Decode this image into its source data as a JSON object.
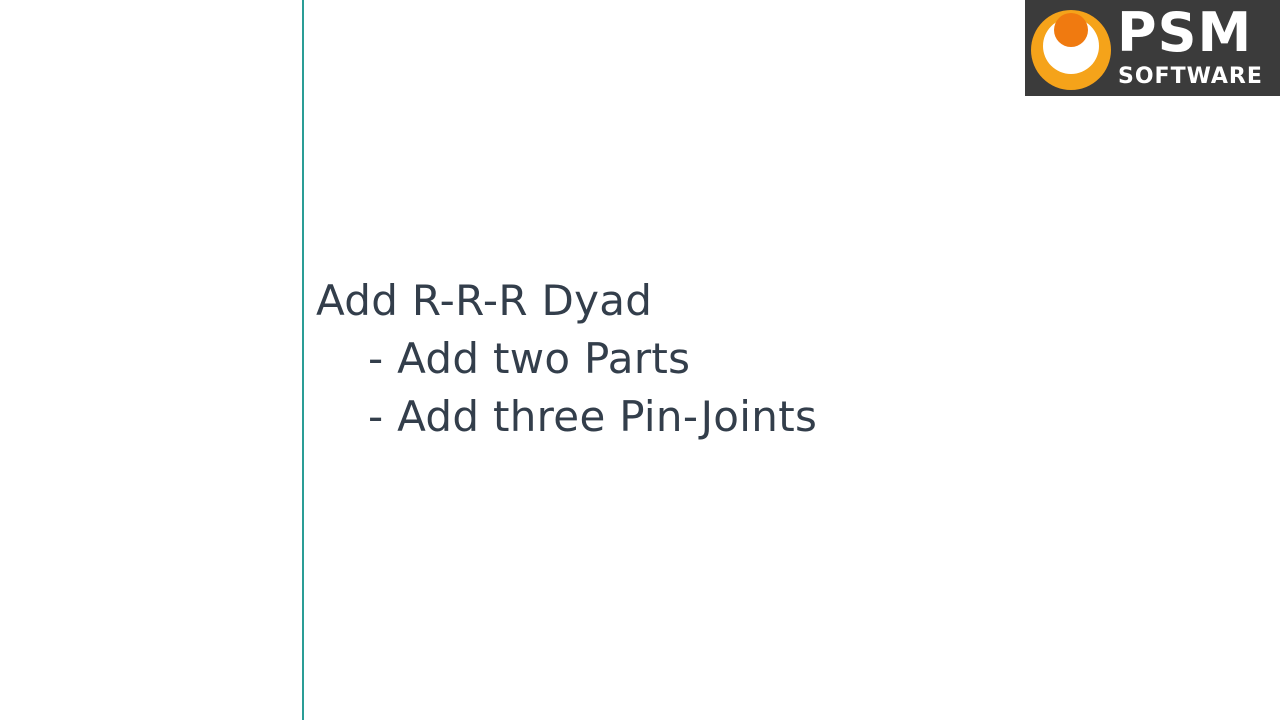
{
  "slide": {
    "heading": "Add R-R-R Dyad",
    "bullets": [
      "- Add two Parts",
      "- Add three Pin-Joints"
    ]
  },
  "logo": {
    "main_text": "PSM",
    "sub_text": "SOFTWARE",
    "colors": {
      "background": "#3b3b3b",
      "ring": "#f5a31a",
      "dot": "#f07a10",
      "text": "#ffffff"
    }
  },
  "accent_color": "#2a9d96",
  "text_color": "#333e4b"
}
